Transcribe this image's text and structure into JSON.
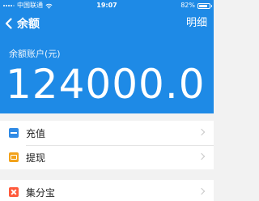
{
  "status_bar": {
    "carrier": "中国联通",
    "time": "19:07",
    "battery_text": "82%",
    "battery_level": 0.82,
    "signal_bars": 5,
    "signal_on": 4
  },
  "nav": {
    "back_icon": "chevron-left-icon",
    "title": "余额",
    "detail": "明细"
  },
  "balance": {
    "label": "余额账户(元)",
    "amount": "124000.0"
  },
  "menu": {
    "group1": [
      {
        "label": "充值",
        "icon": "recharge-icon"
      },
      {
        "label": "提现",
        "icon": "withdraw-icon"
      }
    ],
    "group2": [
      {
        "label": "集分宝",
        "icon": "jifenbao-icon"
      }
    ]
  },
  "colors": {
    "header_blue": "#1e8ae6",
    "background": "#f2f2f2",
    "recharge_icon": "#2f8ae5",
    "withdraw_icon": "#f2a21b",
    "jifenbao_icon": "#ff5a3c"
  }
}
